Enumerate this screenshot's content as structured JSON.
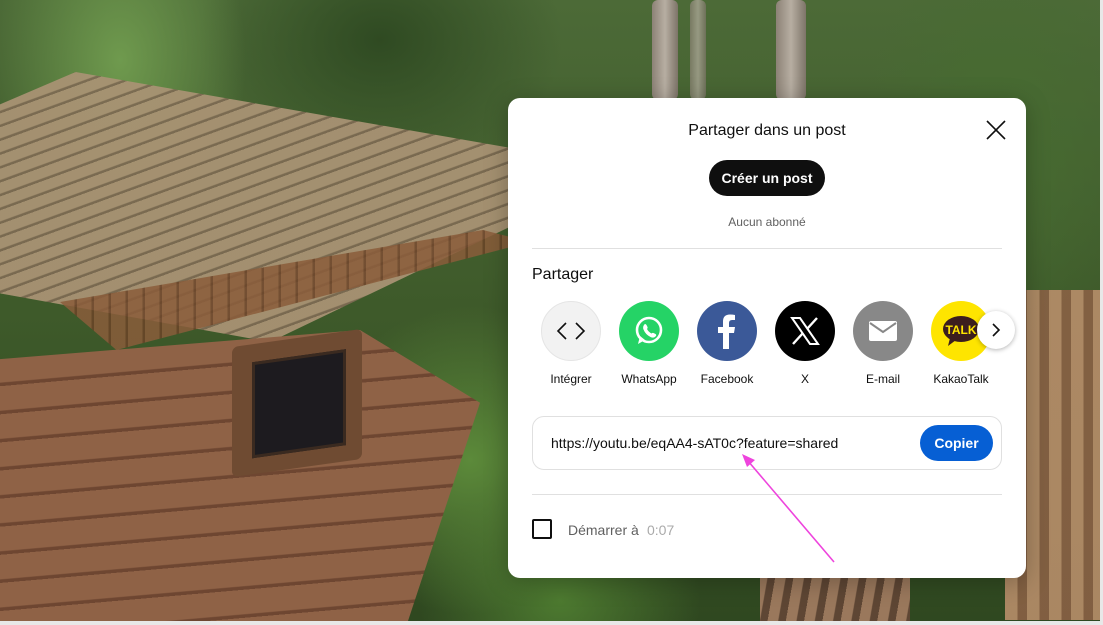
{
  "dialog": {
    "title": "Partager dans un post",
    "create_post_label": "Créer un post",
    "subscribers_text": "Aucun abonné",
    "share_label": "Partager",
    "share_targets": [
      {
        "label": "Intégrer",
        "icon": "embed-icon",
        "color": "#f2f2f2"
      },
      {
        "label": "WhatsApp",
        "icon": "whatsapp-icon",
        "color": "#25d366"
      },
      {
        "label": "Facebook",
        "icon": "facebook-icon",
        "color": "#3b5998"
      },
      {
        "label": "X",
        "icon": "x-icon",
        "color": "#000000"
      },
      {
        "label": "E-mail",
        "icon": "email-icon",
        "color": "#888888"
      },
      {
        "label": "KakaoTalk",
        "icon": "kakaotalk-icon",
        "color": "#fee500"
      }
    ],
    "url": "https://youtu.be/eqAA4-sAT0c?feature=shared",
    "copy_label": "Copier",
    "start_at_label": "Démarrer à",
    "start_at_time": "0:07",
    "kakao_badge": "TALK"
  },
  "colors": {
    "copy_button": "#065fd4",
    "create_post_button": "#0f0f0f",
    "annotation_arrow": "#ee44dd"
  }
}
